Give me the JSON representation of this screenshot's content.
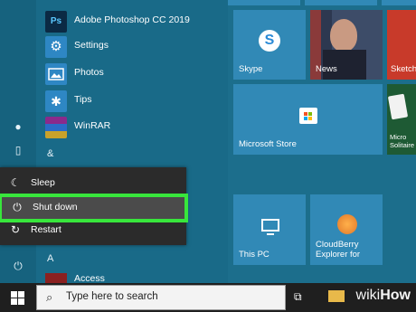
{
  "apps": [
    {
      "label": "Adobe Photoshop CC 2019",
      "icon": "photoshop-icon"
    },
    {
      "label": "Settings",
      "icon": "gear-icon"
    },
    {
      "label": "Photos",
      "icon": "photos-icon"
    },
    {
      "label": "Tips",
      "icon": "lightbulb-icon"
    },
    {
      "label": "WinRAR",
      "icon": "winrar-icon"
    }
  ],
  "section_letters": [
    "&",
    "A"
  ],
  "list_tail": "Access",
  "power_menu": {
    "sleep": "Sleep",
    "shutdown": "Shut down",
    "restart": "Restart"
  },
  "tiles": {
    "skype": "Skype",
    "news": "News",
    "sketch": "Sketch",
    "store": "Microsoft Store",
    "solitaire": "Micro Solitaire",
    "thispc": "This PC",
    "cloudberry": "CloudBerry Explorer for"
  },
  "search": {
    "placeholder": "Type here to search"
  },
  "watermark": {
    "wiki": "wiki",
    "how": "How"
  },
  "colors": {
    "highlight": "#38e63c",
    "tile": "#3189b6"
  }
}
